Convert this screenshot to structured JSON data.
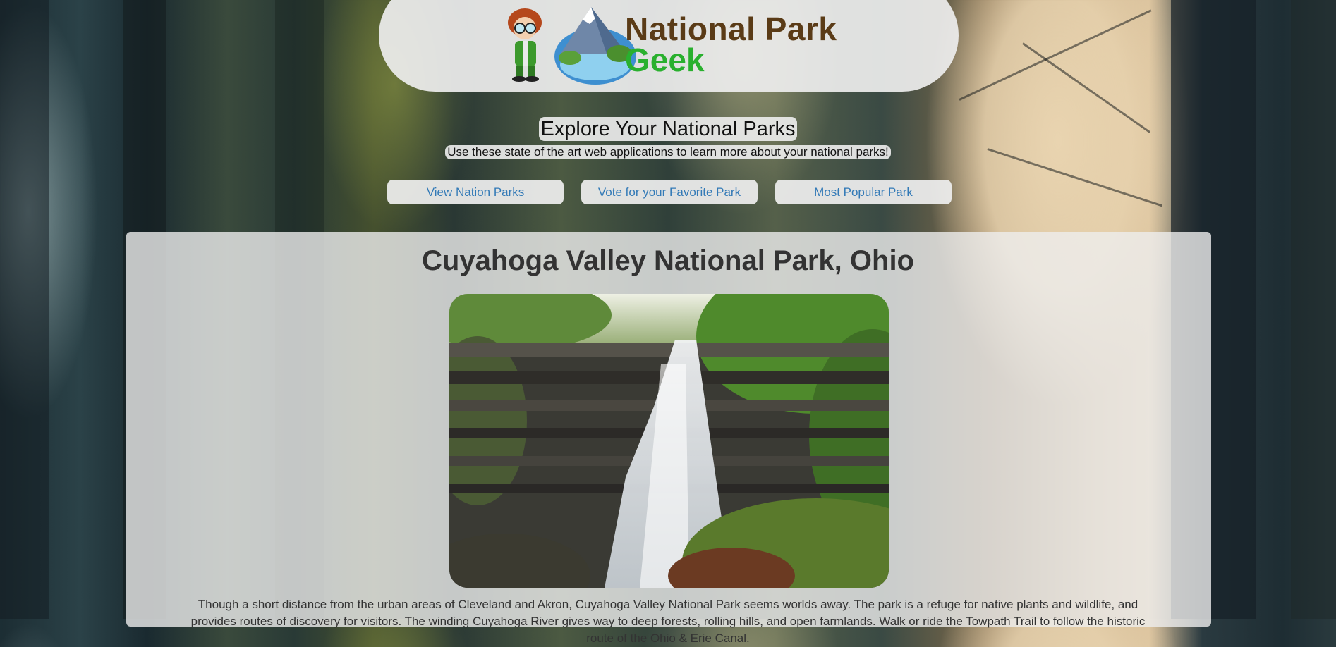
{
  "site": {
    "logo_line1": "National Park",
    "logo_line2": "Geek"
  },
  "hero": {
    "title": "Explore Your National Parks",
    "subtitle": "Use these state of the art web applications to learn more about your national parks!"
  },
  "nav": {
    "view_parks": "View Nation Parks",
    "vote": "Vote for your Favorite Park",
    "most_popular": "Most Popular Park"
  },
  "park": {
    "title": "Cuyahoga Valley National Park, Ohio",
    "description": "Though a short distance from the urban areas of Cleveland and Akron, Cuyahoga Valley National Park seems worlds away. The park is a refuge for native plants and wildlife, and provides routes of discovery for visitors. The winding Cuyahoga River gives way to deep forests, rolling hills, and open farmlands. Walk or ride the Towpath Trail to follow the historic route of the Ohio & Erie Canal."
  },
  "colors": {
    "link": "#337ab7",
    "logo_brown": "#5a3b17",
    "logo_green": "#29b02e"
  }
}
